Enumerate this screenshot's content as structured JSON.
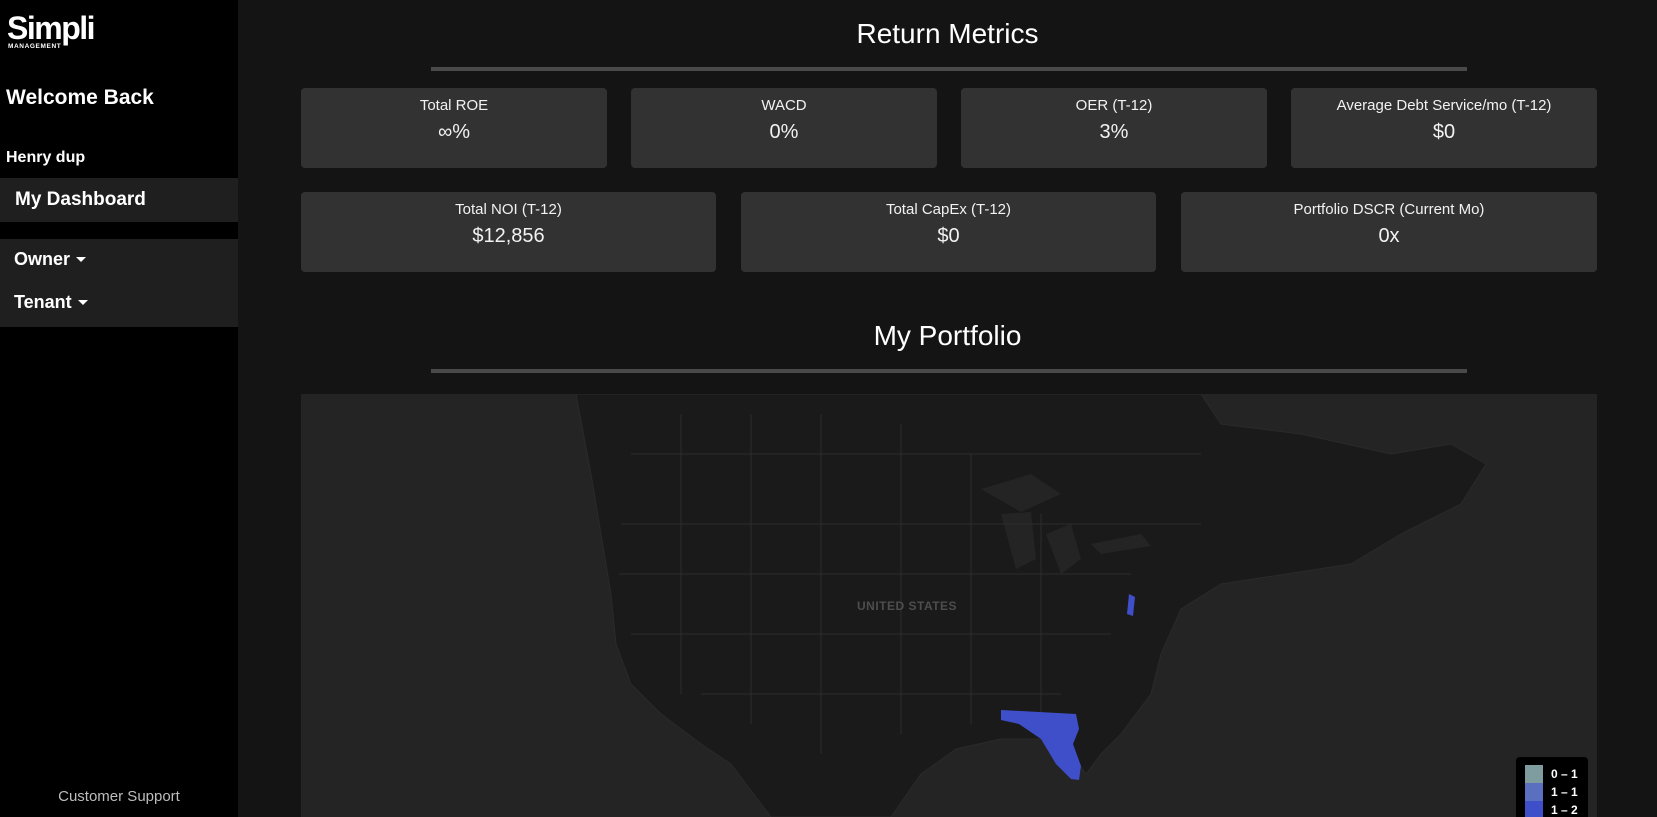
{
  "sidebar": {
    "logo_main": "Simpli",
    "logo_sub": "MANAGEMENT",
    "welcome": "Welcome Back",
    "username": "Henry dup",
    "nav": {
      "dashboard": "My Dashboard",
      "owner": "Owner",
      "tenant": "Tenant"
    },
    "support": "Customer Support"
  },
  "return_metrics": {
    "title": "Return Metrics",
    "row1": [
      {
        "label": "Total ROE",
        "value": "∞%"
      },
      {
        "label": "WACD",
        "value": "0%"
      },
      {
        "label": "OER (T-12)",
        "value": "3%"
      },
      {
        "label": "Average Debt Service/mo (T-12)",
        "value": "$0"
      }
    ],
    "row2": [
      {
        "label": "Total NOI (T-12)",
        "value": "$12,856"
      },
      {
        "label": "Total CapEx (T-12)",
        "value": "$0"
      },
      {
        "label": "Portfolio DSCR (Current Mo)",
        "value": "0x"
      }
    ]
  },
  "portfolio": {
    "title": "My Portfolio",
    "map": {
      "country_label": "UNITED STATES",
      "highlight_color": "#3f4fc9",
      "legend": [
        {
          "label": "0 – 1",
          "color": "#7f9c9e"
        },
        {
          "label": "1 – 1",
          "color": "#5a6fbf"
        },
        {
          "label": "1 – 2",
          "color": "#3f4fc9"
        }
      ]
    }
  }
}
